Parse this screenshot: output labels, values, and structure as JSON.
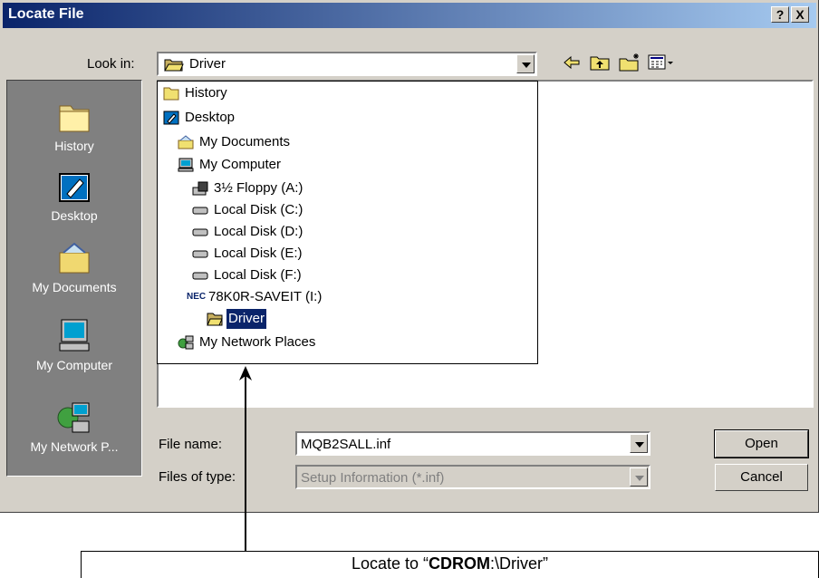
{
  "dialog": {
    "title": "Locate File",
    "help_label": "?",
    "close_label": "X"
  },
  "lookin": {
    "label": "Look in:",
    "value": "Driver"
  },
  "places": [
    {
      "label": "History",
      "icon": "history-folder-icon"
    },
    {
      "label": "Desktop",
      "icon": "desktop-icon"
    },
    {
      "label": "My Documents",
      "icon": "my-documents-icon"
    },
    {
      "label": "My Computer",
      "icon": "my-computer-icon"
    },
    {
      "label": "My Network P...",
      "icon": "network-places-icon"
    }
  ],
  "dropdown_items": [
    {
      "label": "History",
      "icon": "folder-icon"
    },
    {
      "label": "Desktop",
      "icon": "desktop-icon"
    },
    {
      "label": "My Documents",
      "icon": "my-documents-icon"
    },
    {
      "label": "My Computer",
      "icon": "computer-icon"
    },
    {
      "label": "3½ Floppy (A:)",
      "icon": "floppy-icon"
    },
    {
      "label": "Local Disk (C:)",
      "icon": "disk-icon"
    },
    {
      "label": "Local Disk (D:)",
      "icon": "disk-icon"
    },
    {
      "label": "Local Disk (E:)",
      "icon": "disk-icon"
    },
    {
      "label": "Local Disk (F:)",
      "icon": "disk-icon"
    },
    {
      "label": "78K0R-SAVEIT (I:)",
      "icon": "nec-logo-icon",
      "logo_text": "NEC"
    },
    {
      "label": "Driver",
      "icon": "open-folder-icon",
      "selected": true
    },
    {
      "label": "My Network Places",
      "icon": "network-places-icon"
    }
  ],
  "filename": {
    "label": "File name:",
    "value": "MQB2SALL.inf"
  },
  "filetype": {
    "label": "Files of type:",
    "value": "Setup Information (*.inf)"
  },
  "buttons": {
    "open": "Open",
    "cancel": "Cancel"
  },
  "callout": {
    "prefix": "Locate to “",
    "bold": "CDROM",
    "suffix": ":\\Driver”"
  },
  "colors": {
    "title_start": "#0a246a",
    "title_end": "#a6caf0",
    "dialog_bg": "#d4d0c8",
    "selection": "#0a246a"
  }
}
